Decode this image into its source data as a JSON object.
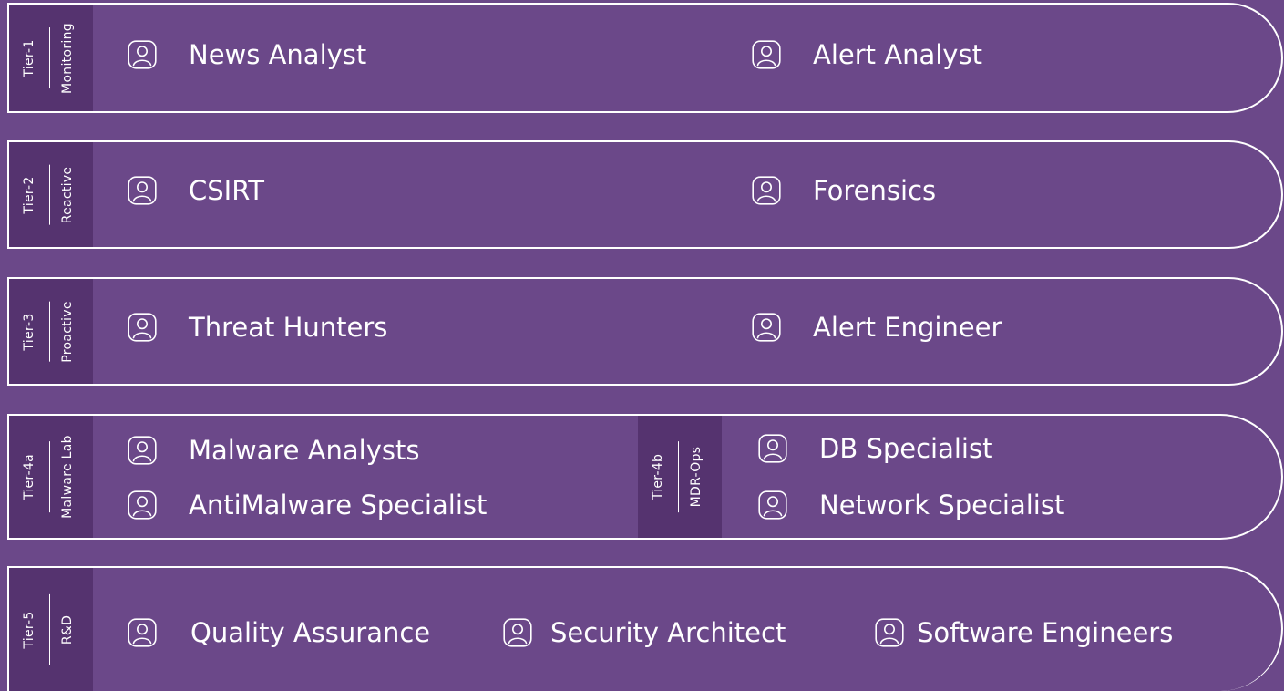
{
  "tiers": [
    {
      "tier": "Tier-1",
      "group": "Monitoring",
      "roles": [
        {
          "label": "News Analyst",
          "icon": "user-icon"
        },
        {
          "label": "Alert Analyst",
          "icon": "user-icon"
        }
      ]
    },
    {
      "tier": "Tier-2",
      "group": "Reactive",
      "roles": [
        {
          "label": "CSIRT",
          "icon": "user-icon"
        },
        {
          "label": "Forensics",
          "icon": "user-icon"
        }
      ]
    },
    {
      "tier": "Tier-3",
      "group": "Proactive",
      "roles": [
        {
          "label": "Threat Hunters",
          "icon": "user-icon"
        },
        {
          "label": "Alert Engineer",
          "icon": "user-icon"
        }
      ]
    },
    {
      "tier": "Tier-4a",
      "group": "Malware Lab",
      "roles": [
        {
          "label": "Malware Analysts",
          "icon": "user-icon"
        },
        {
          "label": "AntiMalware Specialist",
          "icon": "user-icon"
        }
      ],
      "sub_tier": "Tier-4b",
      "sub_group": "MDR-Ops",
      "sub_roles": [
        {
          "label": "DB Specialist",
          "icon": "user-icon"
        },
        {
          "label": "Network Specialist",
          "icon": "user-icon"
        }
      ]
    },
    {
      "tier": "Tier-5",
      "group": "R&D",
      "roles": [
        {
          "label": "Quality Assurance",
          "icon": "user-icon"
        },
        {
          "label": "Security Architect",
          "icon": "user-icon"
        },
        {
          "label": "Software Engineers",
          "icon": "user-icon"
        }
      ]
    }
  ],
  "colors": {
    "background": "#6B4889",
    "label_block": "#55336F",
    "outline": "#FFFFFF",
    "text": "#FFFFFF"
  }
}
